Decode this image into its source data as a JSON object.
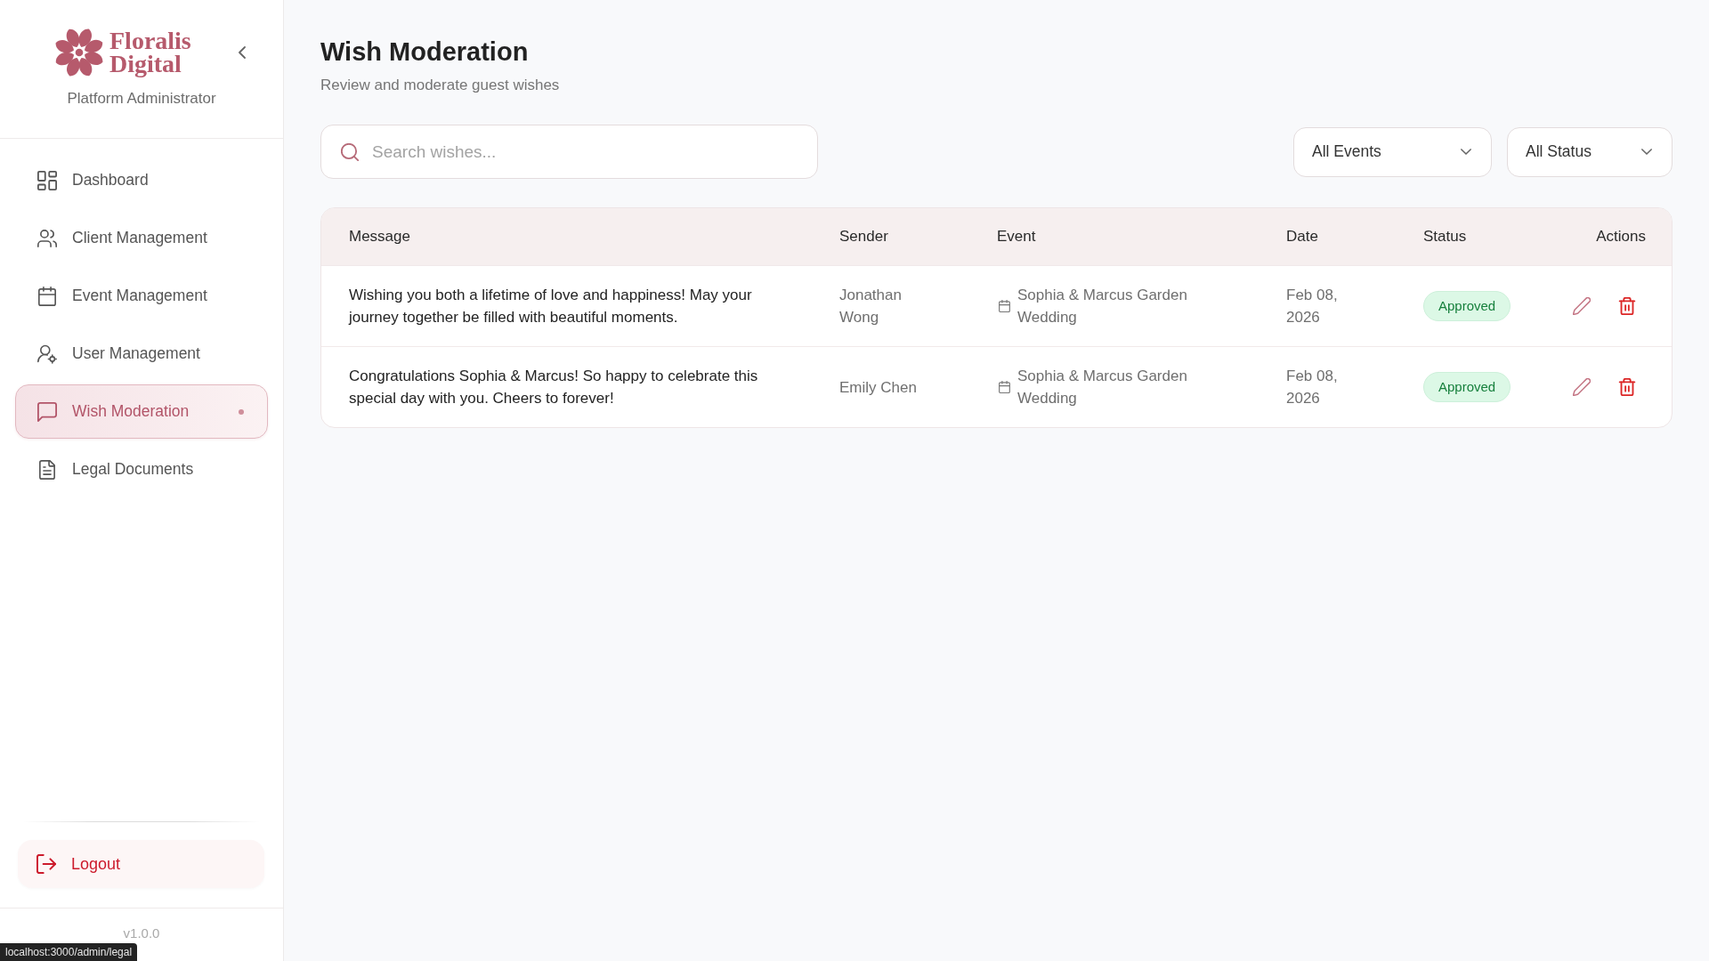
{
  "sidebar": {
    "brand": "Floralis Digital",
    "role": "Platform Administrator",
    "nav_items": [
      {
        "label": "Dashboard",
        "selected": false
      },
      {
        "label": "Client Management",
        "selected": false
      },
      {
        "label": "Event Management",
        "selected": false
      },
      {
        "label": "User Management",
        "selected": false
      },
      {
        "label": "Wish Moderation",
        "selected": true
      },
      {
        "label": "Legal Documents",
        "selected": false
      }
    ],
    "logout": "Logout",
    "version": "v1.0.0"
  },
  "header": {
    "title": "Wish Moderation",
    "subtitle": "Review and moderate guest wishes"
  },
  "search": {
    "placeholder": "Search wishes..."
  },
  "filters": [
    {
      "value": "All Events"
    },
    {
      "value": "All Status"
    }
  ],
  "table": {
    "columns": [
      "Message",
      "Sender",
      "Event",
      "Date",
      "Status",
      "Actions"
    ],
    "rows": [
      {
        "message": "Wishing you both a lifetime of love and happiness! May your journey together be filled with beautiful moments.",
        "sender": "Jonathan Wong",
        "event": "Sophia & Marcus Garden Wedding",
        "date": "Feb 08, 2026",
        "status": "Approved"
      },
      {
        "message": "Congratulations Sophia & Marcus! So happy to celebrate this special day with you. Cheers to forever!",
        "sender": "Emily Chen",
        "event": "Sophia & Marcus Garden Wedding",
        "date": "Feb 08, 2026",
        "status": "Approved"
      }
    ]
  },
  "browser_status": {
    "url": "localhost:3000/admin/legal"
  }
}
